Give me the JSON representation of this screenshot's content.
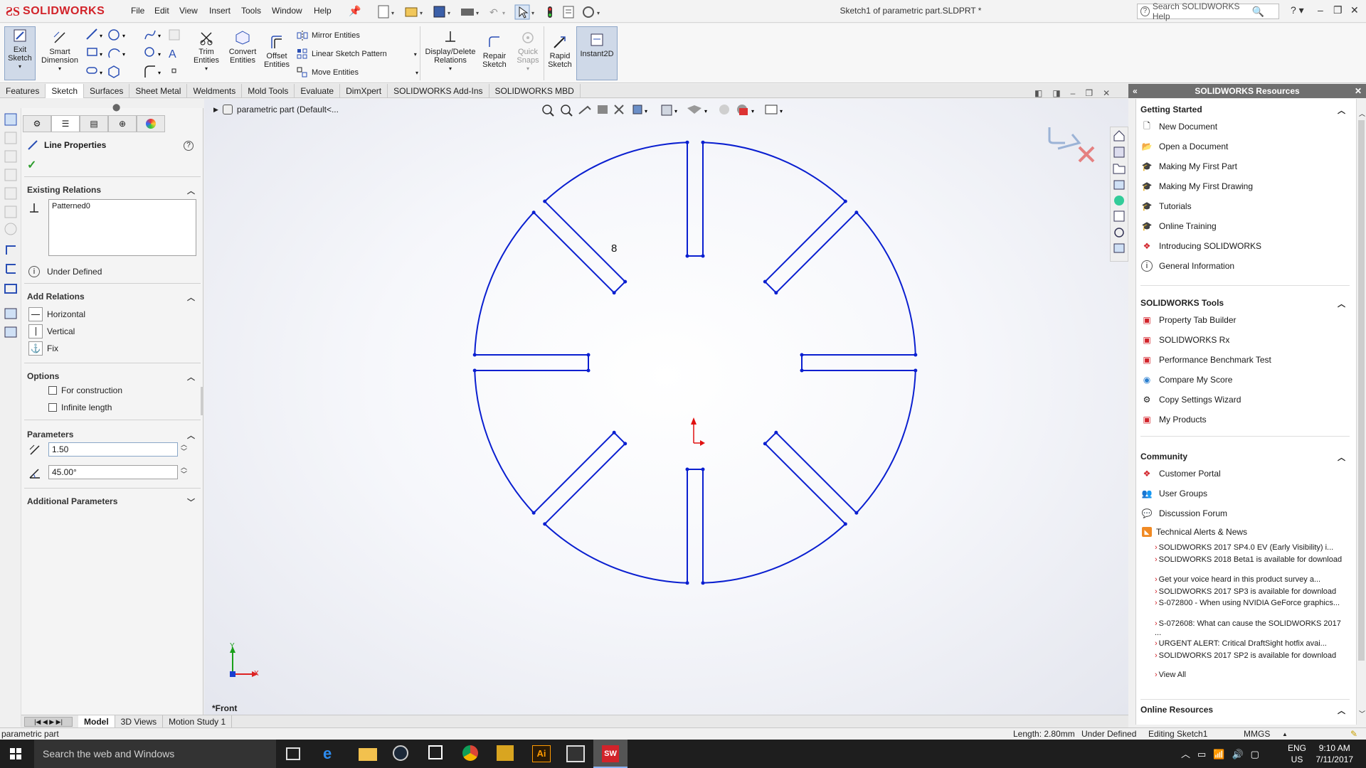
{
  "app": {
    "logo_text": "SOLIDWORKS",
    "document_title": "Sketch1 of parametric part.SLDPRT *",
    "search_placeholder": "Search SOLIDWORKS Help",
    "menu": [
      "File",
      "Edit",
      "View",
      "Insert",
      "Tools",
      "Window",
      "Help"
    ]
  },
  "command_manager": {
    "exit_sketch": "Exit Sketch",
    "smart_dimension": "Smart Dimension",
    "trim_entities": "Trim Entities",
    "convert_entities": "Convert Entities",
    "offset_entities": "Offset Entities",
    "mirror_entities": "Mirror Entities",
    "linear_sketch_pattern": "Linear Sketch Pattern",
    "move_entities": "Move Entities",
    "display_delete_relations": "Display/Delete Relations",
    "repair_sketch": "Repair Sketch",
    "quick_snaps": "Quick Snaps",
    "rapid_sketch": "Rapid Sketch",
    "instant2d": "Instant2D"
  },
  "tabs": [
    "Features",
    "Sketch",
    "Surfaces",
    "Sheet Metal",
    "Weldments",
    "Mold Tools",
    "Evaluate",
    "DimXpert",
    "SOLIDWORKS Add-Ins",
    "SOLIDWORKS MBD"
  ],
  "active_tab": "Sketch",
  "property_manager": {
    "title": "Line Properties",
    "existing_relations_header": "Existing Relations",
    "existing_relations": [
      "Patterned0"
    ],
    "status": "Under Defined",
    "add_relations_header": "Add Relations",
    "add_relations": [
      "Horizontal",
      "Vertical",
      "Fix"
    ],
    "options_header": "Options",
    "options": [
      {
        "label": "For construction",
        "checked": false
      },
      {
        "label": "Infinite length",
        "checked": false
      }
    ],
    "parameters_header": "Parameters",
    "length_value": "1.50",
    "angle_value": "45.00°",
    "additional_parameters_header": "Additional Parameters"
  },
  "graphics": {
    "breadcrumb": "parametric part  (Default<...",
    "view_name": "*Front",
    "dimension_label": "8",
    "axis_x": "X",
    "axis_y": "Y"
  },
  "resources": {
    "header": "SOLIDWORKS Resources",
    "getting_started_header": "Getting Started",
    "getting_started": [
      "New Document",
      "Open a Document",
      "Making My First Part",
      "Making My First Drawing",
      "Tutorials",
      "Online Training",
      "Introducing SOLIDWORKS",
      "General Information"
    ],
    "tools_header": "SOLIDWORKS Tools",
    "tools": [
      "Property Tab Builder",
      "SOLIDWORKS Rx",
      "Performance Benchmark Test",
      "Compare My Score",
      "Copy Settings Wizard",
      "My Products"
    ],
    "community_header": "Community",
    "community": [
      "Customer Portal",
      "User Groups",
      "Discussion Forum",
      "Technical Alerts & News"
    ],
    "news": [
      "SOLIDWORKS 2017 SP4.0 EV (Early Visibility) i...",
      "SOLIDWORKS 2018 Beta1 is available for download",
      "Get your voice heard in this product survey a...",
      "SOLIDWORKS 2017 SP3 is available for download",
      "S-072800 - When using NVIDIA GeForce graphics...",
      "S-072608: What can cause the SOLIDWORKS 2017 ...",
      "URGENT ALERT: Critical DraftSight hotfix avai...",
      "SOLIDWORKS 2017 SP2 is available for download"
    ],
    "view_all": "View All",
    "online_resources_header": "Online Resources"
  },
  "bottom_tabs": [
    "Model",
    "3D Views",
    "Motion Study 1"
  ],
  "active_bottom_tab": "Model",
  "status_bar": {
    "left": "parametric part",
    "length": "Length: 2.80mm",
    "defined": "Under Defined",
    "editing": "Editing Sketch1",
    "units": "MMGS"
  },
  "taskbar": {
    "search_placeholder": "Search the web and Windows",
    "lang_top": "ENG",
    "lang_bottom": "US",
    "time": "9:10 AM",
    "date": "7/11/2017"
  },
  "colors": {
    "sketch_blue": "#0a1fd0",
    "brand_red": "#d2232a",
    "origin_red": "#e01010"
  }
}
